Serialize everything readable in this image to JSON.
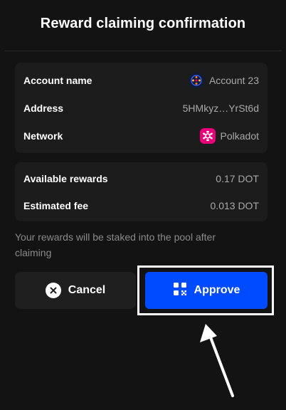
{
  "modal": {
    "title": "Reward claiming confirmation"
  },
  "details": {
    "account_label": "Account name",
    "account_value": "Account 23",
    "address_label": "Address",
    "address_value": "5HMkyz…YrSt6d",
    "network_label": "Network",
    "network_value": "Polkadot"
  },
  "rewards": {
    "available_label": "Available rewards",
    "available_value": "0.17 DOT",
    "fee_label": "Estimated fee",
    "fee_value": "0.013 DOT"
  },
  "info": {
    "text": "Your rewards will be staked into the pool after claiming"
  },
  "buttons": {
    "cancel_label": "Cancel",
    "approve_label": "Approve"
  },
  "colors": {
    "background": "#131313",
    "card": "#1c1c1c",
    "accent": "#004bff",
    "polkadot": "#e6007a"
  },
  "icons": {
    "account": "account-avatar-icon",
    "network": "polkadot-icon",
    "cancel": "close-circle-icon",
    "approve": "qr-scan-icon",
    "annotation": "arrow-pointer-icon"
  }
}
